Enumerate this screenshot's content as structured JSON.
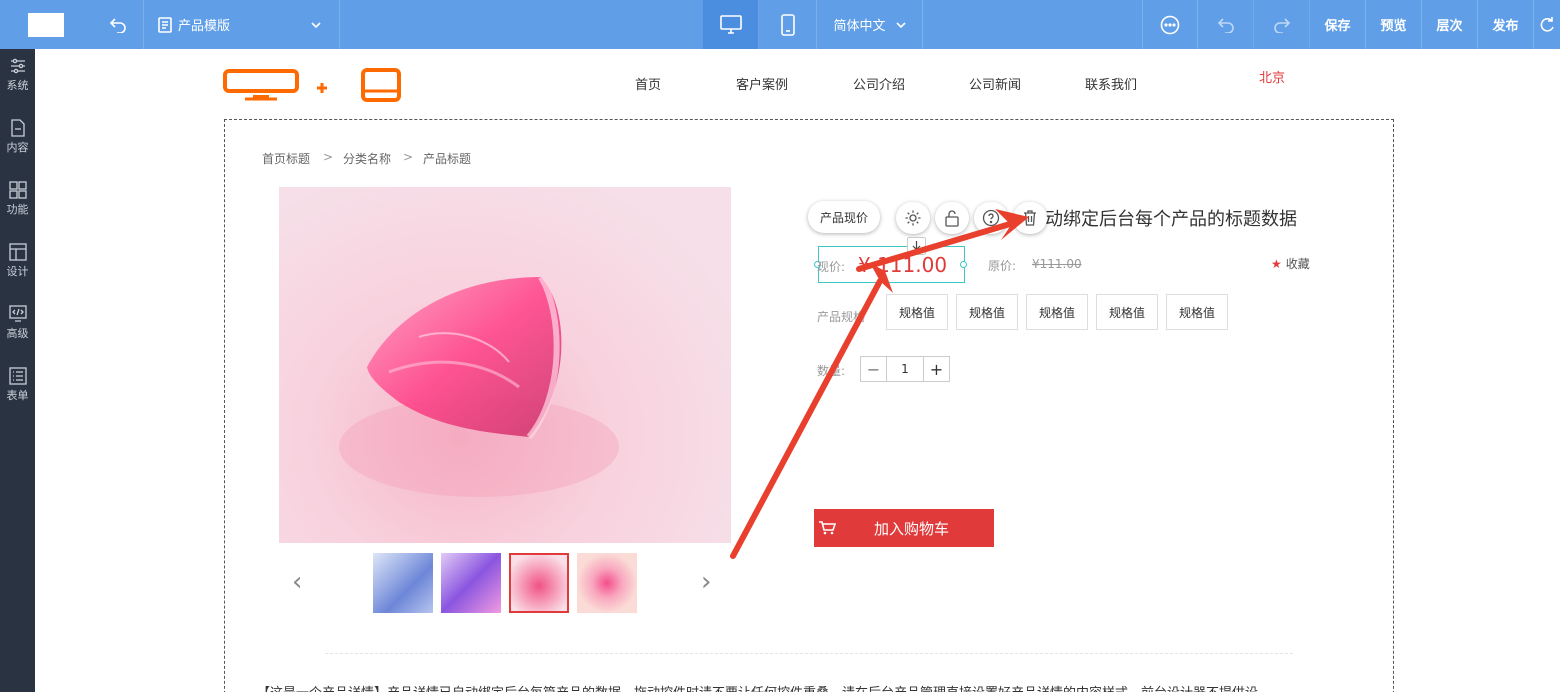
{
  "topbar": {
    "template_label": "产品模版",
    "language": "简体中文",
    "save": "保存",
    "preview": "预览",
    "layers": "层次",
    "publish": "发布"
  },
  "sidebar": {
    "items": [
      {
        "label": "系统",
        "icon": "sliders-icon"
      },
      {
        "label": "内容",
        "icon": "document-icon"
      },
      {
        "label": "功能",
        "icon": "grid-icon"
      },
      {
        "label": "设计",
        "icon": "layout-icon"
      },
      {
        "label": "高级",
        "icon": "code-icon"
      },
      {
        "label": "表单",
        "icon": "form-icon"
      }
    ]
  },
  "site": {
    "nav": [
      "首页",
      "客户案例",
      "公司介绍",
      "公司新闻",
      "联系我们"
    ],
    "city": "北京"
  },
  "breadcrumb": [
    "首页标题",
    "分类名称",
    "产品标题"
  ],
  "product": {
    "title_visible": "动绑定后台每个产品的标题数据",
    "price_label": "现价:",
    "price": "¥ 111.00",
    "orig_label": "原价:",
    "orig_price": "¥111.00",
    "favorite": "收藏",
    "spec_label": "产品规格",
    "spec_values": [
      "规格值",
      "规格值",
      "规格值",
      "规格值",
      "规格值"
    ],
    "qty_label": "数量:",
    "qty": "1",
    "add_cart": "加入购物车",
    "description": "【这是一个产品详情】产品详情已自动绑定后台每篇产品的数据，拖动控件时请不要让任何控件重叠，请在后台产品管理直接设置好产品详情的内容样式，前台设计器不提供设"
  },
  "toolbar": {
    "tag": "产品现价"
  },
  "colors": {
    "topbar": "#609fe8",
    "sidebar": "#2a3341",
    "accent": "#e03a3a",
    "arrow": "#e8402d",
    "logo": "#ff6a00",
    "selection": "#3cc6c6"
  }
}
